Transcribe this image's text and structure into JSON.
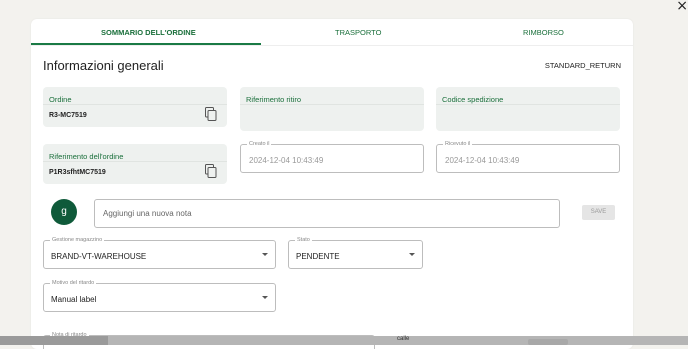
{
  "window": {
    "close_glyph": "×"
  },
  "tabs": [
    {
      "label": "SOMMARIO DELL'ORDINE",
      "active": true
    },
    {
      "label": "TRASPORTO",
      "active": false
    },
    {
      "label": "RIMBORSO",
      "active": false
    }
  ],
  "section": {
    "title": "Informazioni generali",
    "status_code": "STANDARD_RETURN"
  },
  "info": {
    "order": {
      "label": "Ordine",
      "value": "R3-MC7519"
    },
    "pickup_ref": {
      "label": "Riferimento ritiro",
      "value": ""
    },
    "shipment_code": {
      "label": "Codice spedizione",
      "value": ""
    },
    "order_ref": {
      "label": "Riferimento dell'ordine",
      "value": "P1R3sfhtMC7519"
    },
    "created": {
      "label": "Creato il",
      "value": "2024-12-04 10:43:49"
    },
    "received": {
      "label": "Ricevuto il",
      "value": "2024-12-04 10:43:49"
    }
  },
  "note": {
    "avatar_initial": "g",
    "placeholder": "Aggiungi una nuova nota",
    "save_label": "SAVE"
  },
  "warehouse": {
    "label": "Gestione magazzino",
    "value": "BRAND-VT-WAREHOUSE"
  },
  "state": {
    "label": "Stato",
    "value": "PENDENTE"
  },
  "delay": {
    "label": "Motivo del ritardo",
    "value": "Manual label"
  },
  "delay_note": {
    "label": "Nota di ritardo"
  },
  "background": {
    "cell_text": "calle"
  },
  "colors": {
    "accent": "#1a7a45",
    "avatar": "#0f5a3a",
    "info_box": "#eef1ef"
  },
  "icons": {
    "copy": "copy-icon",
    "close": "close-icon",
    "dropdown": "chevron-down-icon"
  }
}
